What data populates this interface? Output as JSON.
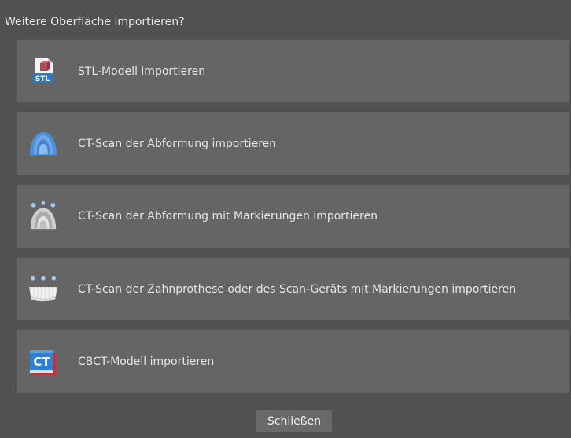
{
  "dialog": {
    "title": "Weitere Oberfläche importieren?",
    "options": [
      {
        "label": "STL-Modell importieren",
        "icon": "stl-file-icon"
      },
      {
        "label": "CT-Scan der Abformung importieren",
        "icon": "impression-icon"
      },
      {
        "label": "CT-Scan der Abformung mit Markierungen importieren",
        "icon": "impression-markers-icon"
      },
      {
        "label": "CT-Scan der Zahnprothese oder des Scan-Geräts mit Markierungen importieren",
        "icon": "denture-markers-icon"
      },
      {
        "label": "CBCT-Modell importieren",
        "icon": "cbct-icon",
        "icon_text": "CT"
      }
    ],
    "close_label": "Schließen"
  },
  "colors": {
    "background": "#515151",
    "option_background": "#656565",
    "text": "#e6e6e6",
    "accent_blue": "#2f7fd6",
    "accent_red": "#c8313a"
  }
}
